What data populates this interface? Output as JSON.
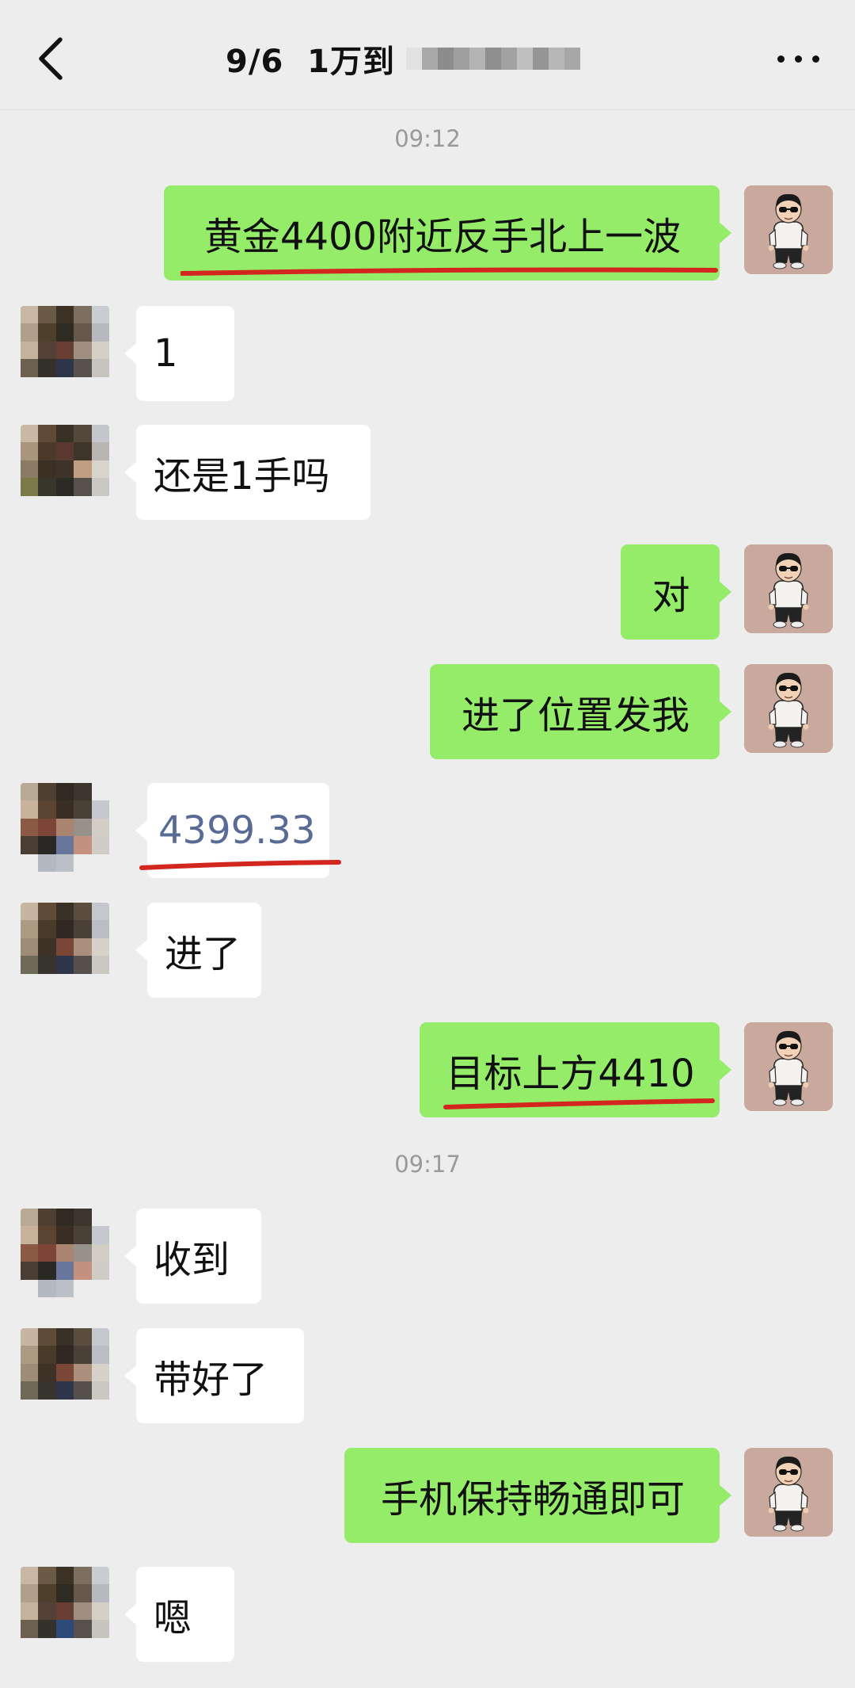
{
  "header": {
    "title": "9/6  1万到",
    "back_icon": "chevron-left-icon",
    "more_icon": "more-dots-icon"
  },
  "chat": {
    "timestamps": [
      "09:12",
      "09:17"
    ],
    "messages": [
      {
        "sender": "self",
        "text": "黄金4400附近反手北上一波"
      },
      {
        "sender": "peer",
        "text": "1"
      },
      {
        "sender": "peer",
        "text": "还是1手吗"
      },
      {
        "sender": "self",
        "text": "对"
      },
      {
        "sender": "self",
        "text": "进了位置发我"
      },
      {
        "sender": "peer",
        "text": "4399.33"
      },
      {
        "sender": "peer",
        "text": "进了"
      },
      {
        "sender": "self",
        "text": "目标上方4410"
      },
      {
        "sender": "peer",
        "text": "收到"
      },
      {
        "sender": "peer",
        "text": "带好了"
      },
      {
        "sender": "self",
        "text": "手机保持畅通即可"
      },
      {
        "sender": "peer",
        "text": "嗯"
      }
    ]
  },
  "colors": {
    "background": "#ededed",
    "self_bubble": "#95ec69",
    "peer_bubble": "#ffffff",
    "link_text": "#576b95",
    "annotation_underline": "#d2261e"
  }
}
